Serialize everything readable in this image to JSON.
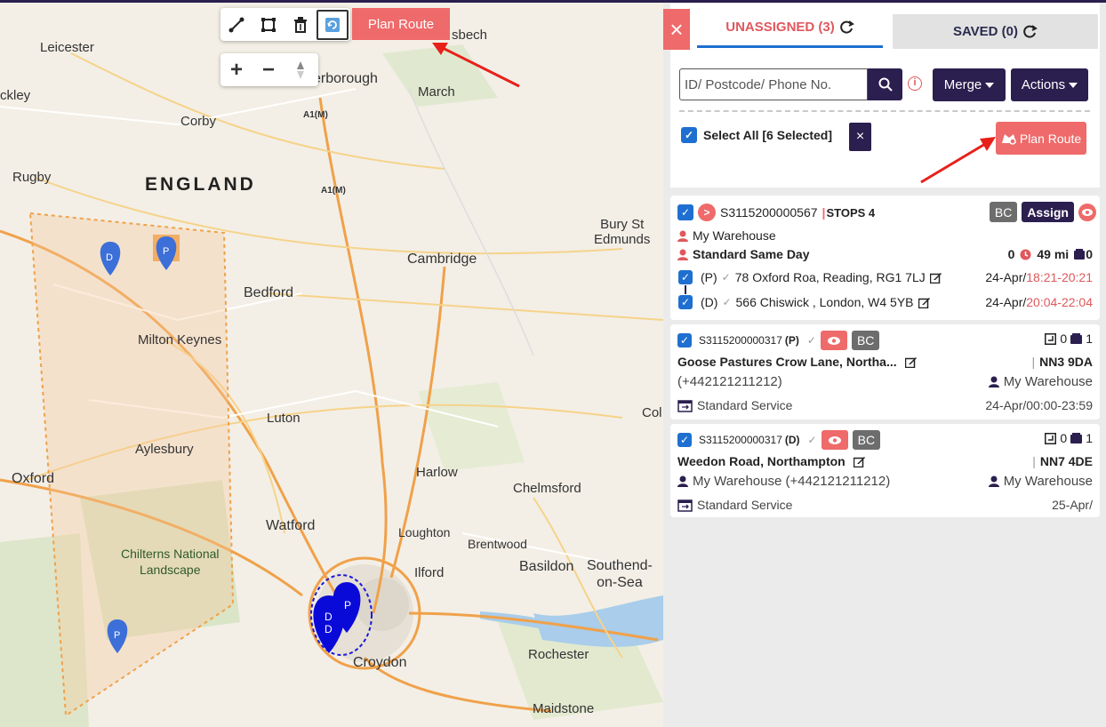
{
  "map": {
    "places": {
      "leicester": "Leicester",
      "ckley": "ckley",
      "peterborough": "erborough",
      "sbech": "sbech",
      "march": "March",
      "corby": "Corby",
      "a1m_1": "A1(M)",
      "a1m_2": "A1(M)",
      "rugby": "Rugby",
      "england": "ENGLAND",
      "bury": "Bury St\nEdmunds",
      "cambridge": "Cambridge",
      "bedford": "Bedford",
      "milton_keynes": "Milton Keynes",
      "luton": "Luton",
      "aylesbury": "Aylesbury",
      "harlow": "Harlow",
      "chelmsford": "Chelmsford",
      "col": "Col",
      "oxford": "Oxford",
      "watford": "Watford",
      "loughton": "Loughton",
      "brentwood": "Brentwood",
      "chilterns": "Chilterns National\nLandscape",
      "ilford": "Ilford",
      "basildon": "Basildon",
      "southend": "Southend-\non-Sea",
      "croydon": "Croydon",
      "rochester": "Rochester",
      "maidstone": "Maidstone"
    },
    "markers": {
      "d1": "D",
      "p1": "P",
      "p2": "P",
      "cluster_d1": "D",
      "cluster_d2": "D",
      "cluster_p": "P"
    },
    "toolbar": {
      "draw_line_icon": "line-draw-icon",
      "draw_polygon_icon": "polygon-draw-icon",
      "delete_icon": "trash-icon",
      "refresh_icon": "refresh-icon",
      "plan_route_label": "Plan Route"
    },
    "zoom": {
      "in_label": "+",
      "out_label": "−"
    }
  },
  "panel": {
    "close_label": "×",
    "tabs": {
      "unassigned": "UNASSIGNED (3)",
      "saved": "SAVED (0)"
    },
    "search": {
      "placeholder": "ID/ Postcode/ Phone No."
    },
    "info_icon": "i",
    "merge_label": "Merge",
    "actions_label": "Actions",
    "select_all_label": "Select All [6 Selected]",
    "clear_label": "×",
    "plan_route_label": "Plan Route",
    "colors": {
      "accent": "#ef6a6a",
      "navy": "#2b1f4f",
      "checkbox": "#1e6fd0"
    }
  },
  "route_card": {
    "id": "S3115200000567",
    "stops": "STOPS 4",
    "bc": "BC",
    "assign": "Assign",
    "warehouse": "My Warehouse",
    "service": "Standard Same Day",
    "count": "0",
    "distance": "49 mi",
    "packages": "0",
    "stop1": {
      "type": "(P)",
      "address": "78 Oxford Roa, Reading, RG1 7LJ",
      "date": "24-Apr/",
      "window": "18:21-20:21"
    },
    "stop2": {
      "type": "(D)",
      "address": "566 Chiswick , London, W4 5YB",
      "date": "24-Apr/",
      "window": "20:04-22:04"
    }
  },
  "order_cards": [
    {
      "id": "S3115200000317",
      "type": "(P)",
      "bc": "BC",
      "count1": "0",
      "count2": "1",
      "address": "Goose Pastures Crow Lane, Northa...",
      "postcode": "NN3 9DA",
      "phone": "(+442121211212)",
      "warehouse": "My Warehouse",
      "service": "Standard Service",
      "window": "24-Apr/00:00-23:59"
    },
    {
      "id": "S3115200000317",
      "type": "(D)",
      "bc": "BC",
      "count1": "0",
      "count2": "1",
      "address": "Weedon Road, Northampton",
      "postcode": "NN7 4DE",
      "phone": "My Warehouse (+442121211212)",
      "warehouse": "My Warehouse",
      "service": "Standard Service",
      "window": "25-Apr/"
    }
  ]
}
